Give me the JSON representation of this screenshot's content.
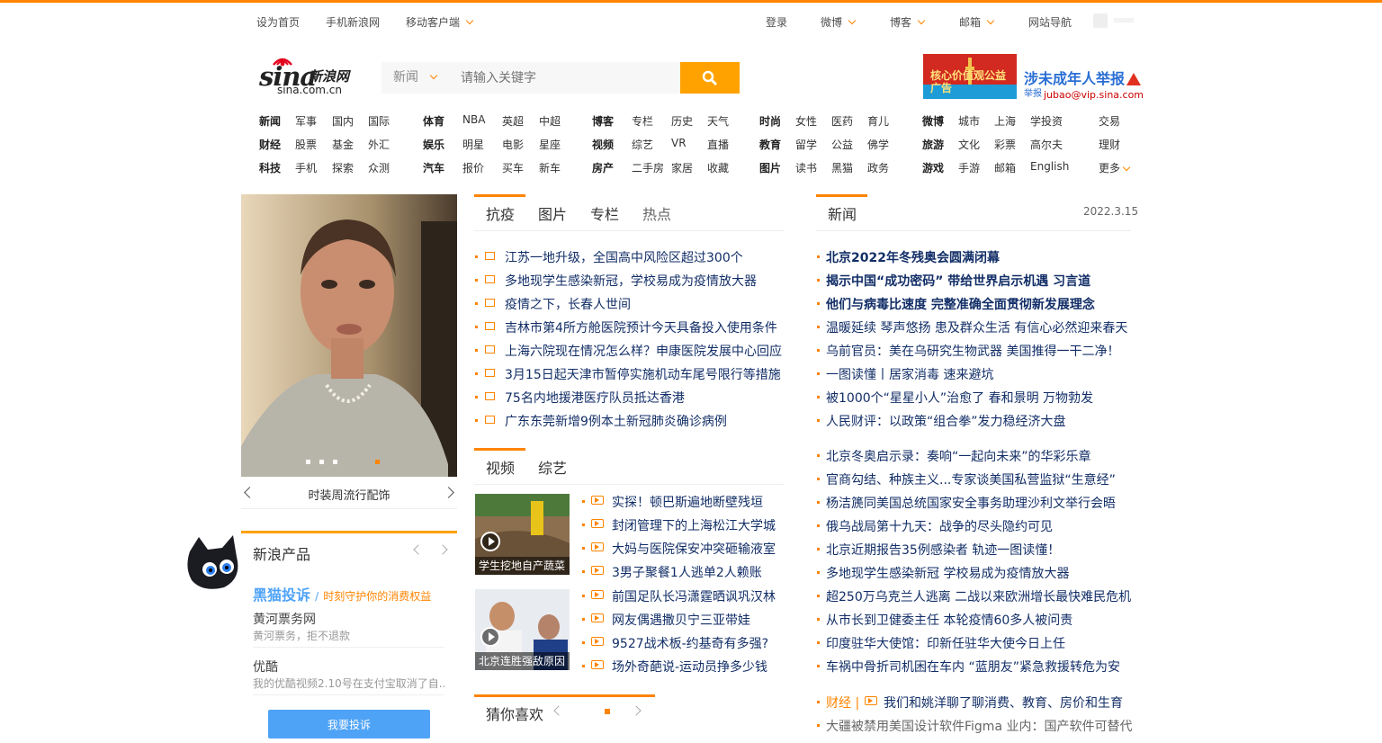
{
  "topbar": {
    "set_home": "设为首页",
    "mobile_sina": "手机新浪网",
    "mobile_client": "移动客户端",
    "login": "登录",
    "weibo": "微博",
    "blog": "博客",
    "mail": "邮箱",
    "site_nav": "网站导航",
    "accent": "#ff8400"
  },
  "logo": {
    "word": "sina",
    "cn": "新浪网",
    "domain": "sina.com.cn"
  },
  "search": {
    "category": "新闻",
    "placeholder": "请输入关键字",
    "button_icon": "search-icon",
    "button_color": "#ffa200"
  },
  "ad_top": {
    "flag_text": "核心价值观公益广告",
    "title": "涉未成年人举报",
    "sub_label": "举报",
    "sub_email": "jubao@vip.sina.com"
  },
  "nav": {
    "col1": [
      [
        "新闻",
        "军事",
        "国内",
        "国际"
      ],
      [
        "财经",
        "股票",
        "基金",
        "外汇"
      ],
      [
        "科技",
        "手机",
        "探索",
        "众测"
      ]
    ],
    "col2": [
      [
        "体育",
        "NBA",
        "英超",
        "中超"
      ],
      [
        "娱乐",
        "明星",
        "电影",
        "星座"
      ],
      [
        "汽车",
        "报价",
        "买车",
        "新车"
      ]
    ],
    "col3": [
      [
        "博客",
        "专栏",
        "历史",
        "天气"
      ],
      [
        "视频",
        "综艺",
        "VR",
        "直播"
      ],
      [
        "房产",
        "二手房",
        "家居",
        "收藏"
      ]
    ],
    "col4": [
      [
        "时尚",
        "女性",
        "医药",
        "育儿"
      ],
      [
        "教育",
        "留学",
        "公益",
        "佛学"
      ],
      [
        "图片",
        "读书",
        "黑猫",
        "政务"
      ]
    ],
    "col5": [
      [
        "微博",
        "城市",
        "上海",
        "学投资",
        "交易"
      ],
      [
        "旅游",
        "文化",
        "彩票",
        "高尔夫",
        "理财"
      ],
      [
        "游戏",
        "手游",
        "邮箱",
        "English",
        "更多"
      ]
    ]
  },
  "carousel": {
    "caption": "时装周流行配饰"
  },
  "products": {
    "title": "新浪产品",
    "heimao": "黑猫投诉",
    "heimao_slogan": "时刻守护你的消费权益",
    "items": [
      {
        "name": "黄河票务网",
        "desc": "黄河票务，拒不退款"
      },
      {
        "name": "优酷",
        "desc": "我的优酷视频2.10号在支付宝取消了自..."
      }
    ],
    "complain_button": "我要投诉"
  },
  "mid_tabs": [
    "抗疫",
    "图片",
    "专栏",
    "热点"
  ],
  "mid_news": [
    "江苏一地升级，全国高中风险区超过300个",
    "多地现学生感染新冠，学校易成为疫情放大器",
    "疫情之下，长春人世间",
    "吉林市第4所方舱医院预计今天具备投入使用条件",
    "上海六院现在情况怎么样？申康医院发展中心回应",
    "3月15日起天津市暂停实施机动车尾号限行等措施",
    "75名内地援港医疗队员抵达香港",
    "广东东莞新增9例本土新冠肺炎确诊病例"
  ],
  "video_tabs": [
    "视频",
    "综艺"
  ],
  "videos": [
    {
      "caption": "学生挖地自产蔬菜"
    },
    {
      "caption": "北京连胜强敌原因"
    }
  ],
  "video_news": [
    "实探！顿巴斯遍地断壁残垣",
    "封闭管理下的上海松江大学城",
    "大妈与医院保安冲突砸输液室",
    "3男子聚餐1人逃单2人赖账",
    "前国足队长冯潇霆晒讽巩汉林",
    "网友偶遇撒贝宁三亚带娃",
    "9527战术板-约基奇有多强?",
    "场外奇葩说-运动员挣多少钱"
  ],
  "guess": {
    "title": "猜你喜欢"
  },
  "right": {
    "tab": "新闻",
    "date": "2022.3.15",
    "headlines": [
      "北京2022年冬残奥会圆满闭幕",
      "揭示中国“成功密码” 带给世界启示机遇 习言道",
      "他们与病毒比速度 完整准确全面贯彻新发展理念"
    ],
    "news1": [
      "温暖延续 琴声悠扬 患及群众生活 有信心必然迎来春天",
      "乌前官员：美在乌研究生物武器 美国推得一干二净！",
      "一图读懂丨居家消毒 速来避坑",
      "被1000个“星星小人”治愈了 春和景明 万物勃发",
      "人民财评：以政策“组合拳”发力稳经济大盘"
    ],
    "news2": [
      "北京冬奥启示录：奏响“一起向未来”的华彩乐章",
      "官商勾结、种族主义...专家谈美国私营监狱“生意经”",
      "杨洁篪同美国总统国家安全事务助理沙利文举行会晤",
      "俄乌战局第十九天：战争的尽头隐约可见",
      "北京近期报告35例感染者 轨迹一图读懂！",
      "多地现学生感染新冠 学校易成为疫情放大器",
      "超250万乌克兰人逃离 二战以来欧洲增长最快难民危机",
      "从市长到卫健委主任 本轮疫情60多人被问责",
      "印度驻华大使馆：印新任驻华大使今日上任",
      "车祸中骨折司机困在车内 “蓝朋友”紧急救援转危为安"
    ],
    "finance_label": "财经 |",
    "finance_news": "我们和姚洋聊了聊消费、教育、房价和生育",
    "last_news": "大疆被禁用美国设计软件Figma 业内：国产软件可替代"
  }
}
